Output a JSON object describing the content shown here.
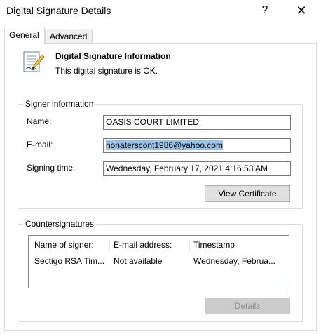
{
  "window": {
    "title": "Digital Signature Details",
    "help_glyph": "?",
    "close_glyph": "✕"
  },
  "tabs": [
    {
      "label": "General",
      "active": true
    },
    {
      "label": "Advanced",
      "active": false
    }
  ],
  "info": {
    "icon": "certificate-document-icon",
    "title": "Digital Signature Information",
    "status": "This digital signature is OK."
  },
  "signer": {
    "group_label": "Signer information",
    "name_label": "Name:",
    "name_value": "OASIS COURT LIMITED",
    "email_label": "E-mail:",
    "email_value": "nonaterscont1986@yahoo.com",
    "time_label": "Signing time:",
    "time_value": "Wednesday, February 17, 2021 4:16:53 AM",
    "view_cert_button": "View Certificate"
  },
  "countersignatures": {
    "group_label": "Countersignatures",
    "columns": [
      "Name of signer:",
      "E-mail address:",
      "Timestamp"
    ],
    "rows": [
      [
        "Sectigo RSA Tim...",
        "Not available",
        "Wednesday, Februa..."
      ]
    ],
    "details_button": "Details"
  },
  "colors": {
    "selection": "#99c2e8",
    "border": "#d9d9d9",
    "button_face": "#e1e1e1"
  }
}
